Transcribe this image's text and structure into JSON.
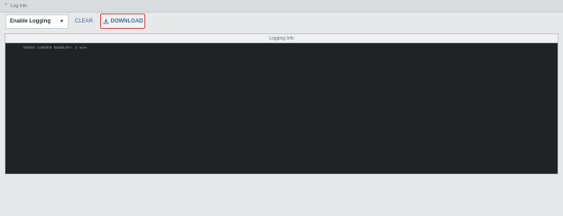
{
  "panel": {
    "title": "Log Info"
  },
  "toolbar": {
    "logging_select": {
      "value": "Enable Logging"
    },
    "clear_label": "CLEAR",
    "download_label": "DOWNLOAD"
  },
  "log": {
    "title": "Logging Info",
    "lines": [
      "DEBUG LOGGER ENABLED: 1 min"
    ]
  },
  "colors": {
    "accent": "#3f6d9c",
    "highlight_border": "#d9534f",
    "log_background": "#1f2326"
  }
}
